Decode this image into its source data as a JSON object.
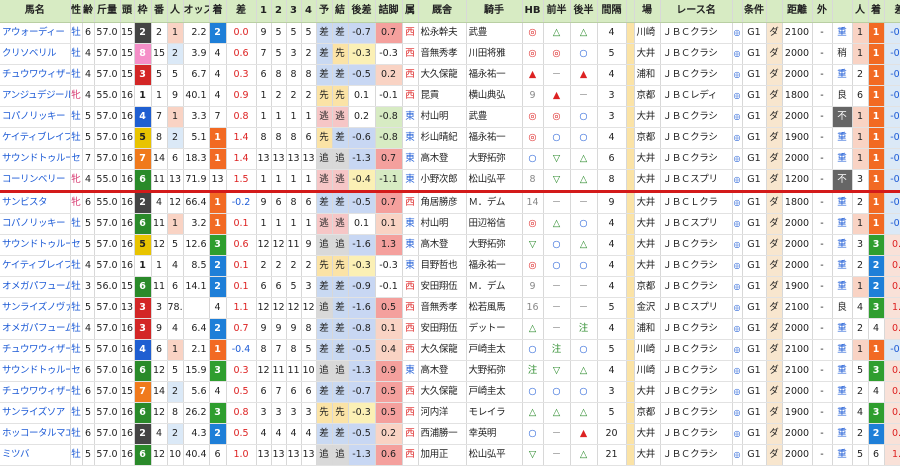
{
  "headers": [
    "馬名",
    "性",
    "齢",
    "斤量",
    "頭",
    "枠",
    "番",
    "人",
    "オッズ",
    "着",
    "差",
    "1",
    "2",
    "3",
    "4",
    "予",
    "結",
    "後差",
    "詰脚",
    "属",
    "厩舎",
    "騎手",
    "HB",
    "前半",
    "後半",
    "間隔",
    "",
    "場",
    "レース名",
    "",
    "条件",
    "",
    "距離",
    "外",
    "",
    "人",
    "着",
    "差"
  ],
  "colors": {
    "waku": {
      "1": "#ffffff",
      "2": "#444444",
      "3": "#d32626",
      "4": "#1f5fd1",
      "5": "#e8c400",
      "6": "#2a8a2a",
      "7": "#f07a1c",
      "8": "#f58ec8"
    },
    "header_bg": "#d7ebc3",
    "separator": "#d31a1a"
  },
  "rows": [
    {
      "horse": "アウォーディー",
      "sex": "牡",
      "age": "6",
      "kin": "57.0",
      "tou": "15",
      "waku": "2",
      "ban": "2",
      "nin": "1",
      "odds": "2.2",
      "chaku": "2",
      "sa": "0.0",
      "p1": "9",
      "p2": "5",
      "p3": "5",
      "p4": "5",
      "yo": "差",
      "kek": "差",
      "atosa": "-0.7",
      "tsume": "0.7",
      "zoku": "西",
      "kyusha": "松永幹夫",
      "kishu": "武豊",
      "hb": "◎",
      "zen": "△",
      "kou": "△",
      "kan": "4",
      "ba": "川崎",
      "race": "ＪＢＣクラシ",
      "cls": "G1",
      "cond": "ダ",
      "dist": "2100",
      "soto": "-",
      "baba": "重",
      "rn": "1",
      "rc": "1",
      "rs": "-0.1"
    },
    {
      "horse": "クリソベリル",
      "sex": "牡",
      "age": "4",
      "kin": "57.0",
      "tou": "15",
      "waku": "8",
      "ban": "15",
      "nin": "2",
      "odds": "3.9",
      "chaku": "4",
      "sa": "0.6",
      "p1": "7",
      "p2": "5",
      "p3": "3",
      "p4": "2",
      "yo": "差",
      "kek": "先",
      "atosa": "-0.3",
      "tsume": "-0.3",
      "zoku": "西",
      "kyusha": "音無秀孝",
      "kishu": "川田将雅",
      "hb": "◎",
      "zen": "◎",
      "kou": "○",
      "kan": "5",
      "ba": "大井",
      "race": "ＪＢＣクラシ",
      "cls": "G1",
      "cond": "ダ",
      "dist": "2000",
      "soto": "-",
      "baba": "稍",
      "rn": "1",
      "rc": "1",
      "rs": "-0.2"
    },
    {
      "horse": "チュウワウィザード",
      "sex": "牡",
      "age": "4",
      "kin": "57.0",
      "tou": "15",
      "waku": "3",
      "ban": "5",
      "nin": "5",
      "odds": "6.7",
      "chaku": "4",
      "sa": "0.3",
      "p1": "6",
      "p2": "8",
      "p3": "8",
      "p4": "8",
      "yo": "差",
      "kek": "差",
      "atosa": "-0.5",
      "tsume": "0.2",
      "zoku": "西",
      "kyusha": "大久保龍",
      "kishu": "福永祐一",
      "hb": "▲",
      "zen": "－",
      "kou": "▲",
      "kan": "4",
      "ba": "浦和",
      "race": "ＪＢＣクラシ",
      "cls": "G1",
      "cond": "ダ",
      "dist": "2000",
      "soto": "-",
      "baba": "重",
      "rn": "2",
      "rc": "1",
      "rs": "-0.3"
    },
    {
      "horse": "アンジュデジール",
      "sex": "牝",
      "age": "4",
      "kin": "55.0",
      "tou": "16",
      "waku": "1",
      "ban": "1",
      "nin": "9",
      "odds": "40.1",
      "chaku": "4",
      "sa": "0.9",
      "p1": "1",
      "p2": "2",
      "p3": "2",
      "p4": "2",
      "yo": "先",
      "kek": "先",
      "atosa": "0.1",
      "tsume": "-0.1",
      "zoku": "西",
      "kyusha": "昆貢",
      "kishu": "横山典弘",
      "hb": "9",
      "zen": "▲",
      "kou": "－",
      "kan": "3",
      "ba": "京都",
      "race": "ＪＢＣレディ",
      "cls": "G1",
      "cond": "ダ",
      "dist": "1800",
      "soto": "-",
      "baba": "良",
      "rn": "6",
      "rc": "1",
      "rs": "-0.1"
    },
    {
      "horse": "コパノリッキー",
      "sex": "牡",
      "age": "5",
      "kin": "57.0",
      "tou": "16",
      "waku": "4",
      "ban": "7",
      "nin": "1",
      "odds": "3.3",
      "chaku": "7",
      "sa": "0.8",
      "p1": "1",
      "p2": "1",
      "p3": "1",
      "p4": "1",
      "yo": "逃",
      "kek": "逃",
      "atosa": "0.2",
      "tsume": "-0.8",
      "zoku": "東",
      "kyusha": "村山明",
      "kishu": "武豊",
      "hb": "◎",
      "zen": "◎",
      "kou": "○",
      "kan": "3",
      "ba": "大井",
      "race": "ＪＢＣクラシ",
      "cls": "G1",
      "cond": "ダ",
      "dist": "2000",
      "soto": "-",
      "baba": "不",
      "rn": "1",
      "rc": "1",
      "rs": "-0.1"
    },
    {
      "horse": "ケイティブレイブ",
      "sex": "牡",
      "age": "5",
      "kin": "57.0",
      "tou": "16",
      "waku": "5",
      "ban": "8",
      "nin": "2",
      "odds": "5.1",
      "chaku": "1",
      "sa": "1.4",
      "p1": "8",
      "p2": "8",
      "p3": "8",
      "p4": "6",
      "yo": "先",
      "kek": "差",
      "atosa": "-0.6",
      "tsume": "-0.8",
      "zoku": "東",
      "kyusha": "杉山晴紀",
      "kishu": "福永祐一",
      "hb": "◎",
      "zen": "○",
      "kou": "○",
      "kan": "4",
      "ba": "京都",
      "race": "ＪＢＣクラシ",
      "cls": "G1",
      "cond": "ダ",
      "dist": "1900",
      "soto": "-",
      "baba": "重",
      "rn": "1",
      "rc": "1",
      "rs": "-0.1"
    },
    {
      "horse": "サウンドトゥルー",
      "sex": "セ",
      "age": "7",
      "kin": "57.0",
      "tou": "16",
      "waku": "7",
      "ban": "14",
      "nin": "6",
      "odds": "18.3",
      "chaku": "1",
      "sa": "1.4",
      "p1": "13",
      "p2": "13",
      "p3": "13",
      "p4": "13",
      "yo": "追",
      "kek": "追",
      "atosa": "-1.3",
      "tsume": "0.7",
      "zoku": "東",
      "kyusha": "高木登",
      "kishu": "大野拓弥",
      "hb": "○",
      "zen": "▽",
      "kou": "△",
      "kan": "6",
      "ba": "大井",
      "race": "ＪＢＣクラシ",
      "cls": "G1",
      "cond": "ダ",
      "dist": "2000",
      "soto": "-",
      "baba": "重",
      "rn": "1",
      "rc": "1",
      "rs": "-0.1"
    },
    {
      "horse": "コーリンベリー",
      "sex": "牝",
      "age": "4",
      "kin": "55.0",
      "tou": "16",
      "waku": "6",
      "ban": "11",
      "nin": "13",
      "odds": "71.9",
      "chaku": "13",
      "sa": "1.5",
      "p1": "1",
      "p2": "1",
      "p3": "1",
      "p4": "1",
      "yo": "逃",
      "kek": "逃",
      "atosa": "-0.4",
      "tsume": "-1.1",
      "zoku": "東",
      "kyusha": "小野次郎",
      "kishu": "松山弘平",
      "hb": "8",
      "zen": "▽",
      "kou": "△",
      "kan": "8",
      "ba": "大井",
      "race": "ＪＢＣスプリ",
      "cls": "G1",
      "cond": "ダ",
      "dist": "1200",
      "soto": "-",
      "baba": "不",
      "rn": "3",
      "rc": "1",
      "rs": "-0.1"
    },
    {
      "horse": "サンビスタ",
      "sex": "牝",
      "age": "6",
      "kin": "55.0",
      "tou": "16",
      "waku": "2",
      "ban": "4",
      "nin": "12",
      "odds": "66.4",
      "chaku": "1",
      "sa": "-0.2",
      "p1": "9",
      "p2": "6",
      "p3": "8",
      "p4": "6",
      "yo": "差",
      "kek": "差",
      "atosa": "-0.5",
      "tsume": "0.7",
      "zoku": "西",
      "kyusha": "角居勝彦",
      "kishu": "Ｍ．デム",
      "hb": "14",
      "zen": "－",
      "kou": "－",
      "kan": "9",
      "ba": "大井",
      "race": "ＪＢＣＬクラ",
      "cls": "G1",
      "cond": "ダ",
      "dist": "1800",
      "soto": "-",
      "baba": "重",
      "rn": "2",
      "rc": "1",
      "rs": "-0.1"
    },
    {
      "horse": "コパノリッキー",
      "sex": "牡",
      "age": "5",
      "kin": "57.0",
      "tou": "16",
      "waku": "6",
      "ban": "11",
      "nin": "1",
      "odds": "3.2",
      "chaku": "1",
      "sa": "0.1",
      "p1": "1",
      "p2": "1",
      "p3": "1",
      "p4": "1",
      "yo": "逃",
      "kek": "逃",
      "atosa": "0.1",
      "tsume": "0.1",
      "zoku": "東",
      "kyusha": "村山明",
      "kishu": "田辺裕信",
      "hb": "◎",
      "zen": "△",
      "kou": "○",
      "kan": "4",
      "ba": "大井",
      "race": "ＪＢＣスプリ",
      "cls": "G1",
      "cond": "ダ",
      "dist": "2000",
      "soto": "-",
      "baba": "重",
      "rn": "1",
      "rc": "1",
      "rs": "-0.1"
    },
    {
      "horse": "サウンドトゥルー",
      "sex": "セ",
      "age": "5",
      "kin": "57.0",
      "tou": "16",
      "waku": "5",
      "ban": "12",
      "nin": "5",
      "odds": "12.6",
      "chaku": "3",
      "sa": "0.6",
      "p1": "12",
      "p2": "12",
      "p3": "11",
      "p4": "9",
      "yo": "追",
      "kek": "追",
      "atosa": "-1.6",
      "tsume": "1.3",
      "zoku": "東",
      "kyusha": "高木登",
      "kishu": "大野拓弥",
      "hb": "▽",
      "zen": "○",
      "kou": "△",
      "kan": "4",
      "ba": "大井",
      "race": "ＪＢＣクラシ",
      "cls": "G1",
      "cond": "ダ",
      "dist": "2000",
      "soto": "-",
      "baba": "重",
      "rn": "3",
      "rc": "3",
      "rs": "0.6"
    },
    {
      "horse": "ケイティブレイブ",
      "sex": "牡",
      "age": "4",
      "kin": "57.0",
      "tou": "16",
      "waku": "1",
      "ban": "1",
      "nin": "4",
      "odds": "8.5",
      "chaku": "2",
      "sa": "0.1",
      "p1": "2",
      "p2": "2",
      "p3": "2",
      "p4": "2",
      "yo": "先",
      "kek": "先",
      "atosa": "-0.3",
      "tsume": "-0.3",
      "zoku": "東",
      "kyusha": "目野哲也",
      "kishu": "福永祐一",
      "hb": "◎",
      "zen": "○",
      "kou": "○",
      "kan": "4",
      "ba": "大井",
      "race": "ＪＢＣクラシ",
      "cls": "G1",
      "cond": "ダ",
      "dist": "2000",
      "soto": "-",
      "baba": "重",
      "rn": "2",
      "rc": "2",
      "rs": "0.2"
    },
    {
      "horse": "オメガパフューム",
      "sex": "牡",
      "age": "3",
      "kin": "56.0",
      "tou": "15",
      "waku": "6",
      "ban": "11",
      "nin": "6",
      "odds": "14.1",
      "chaku": "2",
      "sa": "0.1",
      "p1": "6",
      "p2": "6",
      "p3": "5",
      "p4": "3",
      "yo": "差",
      "kek": "差",
      "atosa": "-0.9",
      "tsume": "-0.1",
      "zoku": "西",
      "kyusha": "安田翔伍",
      "kishu": "Ｍ．デム",
      "hb": "9",
      "zen": "－",
      "kou": "－",
      "kan": "4",
      "ba": "京都",
      "race": "ＪＢＣクラシ",
      "cls": "G1",
      "cond": "ダ",
      "dist": "1900",
      "soto": "-",
      "baba": "重",
      "rn": "1",
      "rc": "2",
      "rs": "0.1"
    },
    {
      "horse": "サンライズノヴァ",
      "sex": "牡",
      "age": "5",
      "kin": "57.0",
      "tou": "13",
      "waku": "3",
      "ban": "3",
      "nin": "78.9",
      "odds": "",
      "chaku": "4",
      "sa": "1.1",
      "p1": "12",
      "p2": "12",
      "p3": "12",
      "p4": "12",
      "yo": "追",
      "kek": "差",
      "atosa": "-1.6",
      "tsume": "0.5",
      "zoku": "西",
      "kyusha": "音無秀孝",
      "kishu": "松若風馬",
      "hb": "16",
      "zen": "－",
      "kou": "－",
      "kan": "5",
      "ba": "金沢",
      "race": "ＪＢＣスプリ",
      "cls": "G1",
      "cond": "ダ",
      "dist": "2100",
      "soto": "-",
      "baba": "良",
      "rn": "4",
      "rc": "3",
      "rs": "1.1"
    },
    {
      "horse": "オメガパフューム",
      "sex": "牡",
      "age": "4",
      "kin": "57.0",
      "tou": "16",
      "waku": "3",
      "ban": "9",
      "nin": "4",
      "odds": "6.4",
      "chaku": "2",
      "sa": "0.7",
      "p1": "9",
      "p2": "9",
      "p3": "9",
      "p4": "8",
      "yo": "差",
      "kek": "差",
      "atosa": "-0.8",
      "tsume": "0.1",
      "zoku": "西",
      "kyusha": "安田翔伍",
      "kishu": "デットー",
      "hb": "△",
      "zen": "－",
      "kou": "注",
      "kan": "4",
      "ba": "浦和",
      "race": "ＪＢＣクラシ",
      "cls": "G1",
      "cond": "ダ",
      "dist": "2000",
      "soto": "-",
      "baba": "重",
      "rn": "2",
      "rc": "4",
      "rs": "0.7"
    },
    {
      "horse": "チュウワウィザード",
      "sex": "牡",
      "age": "5",
      "kin": "57.0",
      "tou": "16",
      "waku": "4",
      "ban": "6",
      "nin": "1",
      "odds": "2.1",
      "chaku": "1",
      "sa": "-0.4",
      "p1": "8",
      "p2": "7",
      "p3": "8",
      "p4": "5",
      "yo": "差",
      "kek": "差",
      "atosa": "-0.5",
      "tsume": "0.4",
      "zoku": "西",
      "kyusha": "大久保龍",
      "kishu": "戸崎圭太",
      "hb": "○",
      "zen": "注",
      "kou": "○",
      "kan": "5",
      "ba": "川崎",
      "race": "ＪＢＣクラシ",
      "cls": "G1",
      "cond": "ダ",
      "dist": "2100",
      "soto": "-",
      "baba": "重",
      "rn": "1",
      "rc": "1",
      "rs": "-0.4"
    },
    {
      "horse": "サウンドトゥルー",
      "sex": "セ",
      "age": "6",
      "kin": "57.0",
      "tou": "16",
      "waku": "6",
      "ban": "12",
      "nin": "5",
      "odds": "15.9",
      "chaku": "3",
      "sa": "0.3",
      "p1": "12",
      "p2": "11",
      "p3": "11",
      "p4": "10",
      "yo": "追",
      "kek": "追",
      "atosa": "-1.3",
      "tsume": "0.9",
      "zoku": "東",
      "kyusha": "高木登",
      "kishu": "大野拓弥",
      "hb": "注",
      "zen": "▽",
      "kou": "△",
      "kan": "4",
      "ba": "川崎",
      "race": "ＪＢＣクラシ",
      "cls": "G1",
      "cond": "ダ",
      "dist": "2100",
      "soto": "-",
      "baba": "重",
      "rn": "5",
      "rc": "3",
      "rs": "0.3"
    },
    {
      "horse": "チュウワウィザード",
      "sex": "牡",
      "age": "6",
      "kin": "57.0",
      "tou": "15",
      "waku": "7",
      "ban": "14",
      "nin": "2",
      "odds": "5.6",
      "chaku": "4",
      "sa": "0.5",
      "p1": "6",
      "p2": "7",
      "p3": "6",
      "p4": "6",
      "yo": "差",
      "kek": "差",
      "atosa": "-0.7",
      "tsume": "0.5",
      "zoku": "西",
      "kyusha": "大久保龍",
      "kishu": "戸崎圭太",
      "hb": "○",
      "zen": "○",
      "kou": "○",
      "kan": "3",
      "ba": "大井",
      "race": "ＪＢＣクラシ",
      "cls": "G1",
      "cond": "ダ",
      "dist": "2000",
      "soto": "-",
      "baba": "重",
      "rn": "2",
      "rc": "4",
      "rs": "0.5"
    },
    {
      "horse": "サンライズソア",
      "sex": "牡",
      "age": "5",
      "kin": "57.0",
      "tou": "16",
      "waku": "6",
      "ban": "12",
      "nin": "8",
      "odds": "26.2",
      "chaku": "3",
      "sa": "0.8",
      "p1": "3",
      "p2": "3",
      "p3": "3",
      "p4": "3",
      "yo": "先",
      "kek": "先",
      "atosa": "-0.3",
      "tsume": "0.5",
      "zoku": "西",
      "kyusha": "河内洋",
      "kishu": "モレイラ",
      "hb": "△",
      "zen": "△",
      "kou": "△",
      "kan": "5",
      "ba": "京都",
      "race": "ＪＢＣクラシ",
      "cls": "G1",
      "cond": "ダ",
      "dist": "1900",
      "soto": "-",
      "baba": "重",
      "rn": "4",
      "rc": "3",
      "rs": "0.8"
    },
    {
      "horse": "ホッコータルマエ",
      "sex": "牡",
      "age": "6",
      "kin": "57.0",
      "tou": "16",
      "waku": "2",
      "ban": "4",
      "nin": "2",
      "odds": "4.3",
      "chaku": "2",
      "sa": "0.5",
      "p1": "4",
      "p2": "4",
      "p3": "4",
      "p4": "4",
      "yo": "差",
      "kek": "差",
      "atosa": "-0.5",
      "tsume": "0.2",
      "zoku": "西",
      "kyusha": "西浦勝一",
      "kishu": "幸英明",
      "hb": "○",
      "zen": "－",
      "kou": "▲",
      "kan": "20",
      "ba": "大井",
      "race": "ＪＢＣクラシ",
      "cls": "G1",
      "cond": "ダ",
      "dist": "2000",
      "soto": "-",
      "baba": "重",
      "rn": "2",
      "rc": "2",
      "rs": "0.5"
    },
    {
      "horse": "ミツバ",
      "sex": "牡",
      "age": "5",
      "kin": "57.0",
      "tou": "16",
      "waku": "6",
      "ban": "12",
      "nin": "10",
      "odds": "40.4",
      "chaku": "6",
      "sa": "1.0",
      "p1": "13",
      "p2": "13",
      "p3": "13",
      "p4": "13",
      "yo": "追",
      "kek": "追",
      "atosa": "-1.3",
      "tsume": "0.6",
      "zoku": "西",
      "kyusha": "加用正",
      "kishu": "松山弘平",
      "hb": "▽",
      "zen": "－",
      "kou": "△",
      "kan": "21",
      "ba": "大井",
      "race": "ＪＢＣクラシ",
      "cls": "G1",
      "cond": "ダ",
      "dist": "2000",
      "soto": "-",
      "baba": "重",
      "rn": "5",
      "rc": "6",
      "rs": "1.0"
    }
  ]
}
